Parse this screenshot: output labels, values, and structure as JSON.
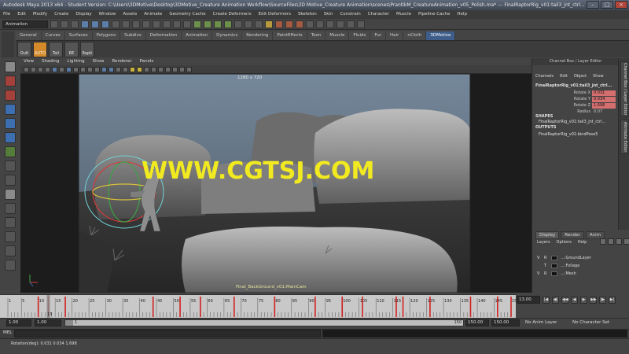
{
  "window": {
    "title": "Autodesk Maya 2013 x64 - Student Version: C:\\Users\\3DMotive\\Desktop\\3DMotive_Creature Animation Workflow\\SourceFiles\\3D Motive_Creature Animation\\scenes\\PrantikM_CreatureAnimation_v05_Polish.ma* --- FinalRaptorRig_v01:tail3_jnt_ctrl..."
  },
  "menubar": {
    "items": [
      "File",
      "Edit",
      "Modify",
      "Create",
      "Display",
      "Window",
      "Assets",
      "Animate",
      "Geometry Cache",
      "Create Deformers",
      "Edit Deformers",
      "Skeleton",
      "Skin",
      "Constrain",
      "Character",
      "Muscle",
      "Pipeline Cache",
      "Help"
    ]
  },
  "statusline": {
    "menuset": "Animation"
  },
  "shelf": {
    "tabs": [
      "General",
      "Curves",
      "Surfaces",
      "Polygons",
      "Subdivs",
      "Deformation",
      "Animation",
      "Dynamics",
      "Rendering",
      "PaintEffects",
      "Toon",
      "Muscle",
      "Fluids",
      "Fur",
      "Hair",
      "nCloth",
      "3DMotive"
    ],
    "active_tab": "3DMotive",
    "buttons": [
      "Outl",
      "AUTO",
      "Tail",
      "RE",
      "Rapti"
    ]
  },
  "viewport": {
    "menu": [
      "View",
      "Shading",
      "Lighting",
      "Show",
      "Renderer",
      "Panels"
    ],
    "resolution_gate": "1280 x 720",
    "camera_name": "Final_BackGround_v01:MainCam",
    "watermark": "WWW.CGTSJ.COM"
  },
  "channel_box": {
    "header": "Channel Box / Layer Editor",
    "menu": [
      "Channels",
      "Edit",
      "Object",
      "Show"
    ],
    "object_name": "FinalRaptorRig_v01:tail3_jnt_ctrl...",
    "attributes": [
      {
        "name": "Rotate X",
        "value": "0.031"
      },
      {
        "name": "Rotate Y",
        "value": "0.034"
      },
      {
        "name": "Rotate Z",
        "value": "1.698"
      },
      {
        "name": "Radius",
        "value": "0.07"
      }
    ],
    "shapes_label": "SHAPES",
    "shape_name": "FinalRaptorRig_v01:tail3_jnt_ctrl...",
    "outputs_label": "OUTPUTS",
    "output_name": "FinalRaptorRig_v01:bindPose5",
    "side_tabs": [
      "Channel Box / Layer Editor",
      "Attribute Editor"
    ]
  },
  "layer_editor": {
    "tabs": [
      "Display",
      "Render",
      "Anim"
    ],
    "active_tab": "Display",
    "menu": [
      "Layers",
      "Options",
      "Help"
    ],
    "layers": [
      {
        "v": "V",
        "type": "R",
        "name": "...:GroundLayer"
      },
      {
        "v": "",
        "type": "T",
        "name": "...:Foliage"
      },
      {
        "v": "V",
        "type": "R",
        "name": "...:Mesh"
      }
    ]
  },
  "timeline": {
    "ticks": [
      "1",
      "5",
      "10",
      "15",
      "20",
      "25",
      "30",
      "35",
      "40",
      "45",
      "50",
      "55",
      "60",
      "65",
      "70",
      "75",
      "80",
      "85",
      "90",
      "95",
      "100",
      "105",
      "110",
      "115",
      "120",
      "125",
      "130",
      "135",
      "140",
      "145",
      "150"
    ],
    "current_frame": "13",
    "current_frame_field": "13.00",
    "keyframes": [
      10,
      13,
      18,
      44,
      52,
      58,
      68,
      80,
      92,
      100,
      106,
      116,
      118,
      126,
      138,
      146,
      150
    ]
  },
  "range": {
    "start": "1.00",
    "playback_start": "1.00",
    "slider_start": "1",
    "slider_end": "150",
    "playback_end": "150.00",
    "end": "150.00",
    "anim_layer": "No Anim Layer",
    "character_set": "No Character Set"
  },
  "command_line": {
    "label": "MEL"
  },
  "help_line": {
    "text": "Rotation(deg): 0.031   0.034   1.698"
  }
}
